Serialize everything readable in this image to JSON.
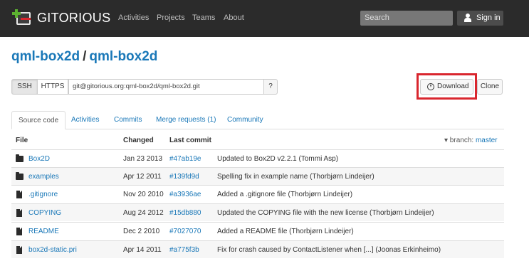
{
  "navbar": {
    "brand": "GITORIOUS",
    "links": [
      "Activities",
      "Projects",
      "Teams",
      "About"
    ],
    "search_placeholder": "Search",
    "signin_label": "Sign in"
  },
  "repo": {
    "project": "qml-box2d",
    "separator": "/",
    "name": "qml-box2d"
  },
  "clone_bar": {
    "ssh_label": "SSH",
    "https_label": "HTTPS",
    "url": "git@gitorious.org:qml-box2d/qml-box2d.git",
    "help_label": "?",
    "download_label": "Download",
    "clone_label": "Clone"
  },
  "tabs": [
    "Source code",
    "Activities",
    "Commits",
    "Merge requests (1)",
    "Community"
  ],
  "table": {
    "headers": {
      "file": "File",
      "changed": "Changed",
      "last_commit": "Last commit"
    },
    "branch_prefix": "▾ branch:",
    "branch_name": "master",
    "rows": [
      {
        "type": "folder",
        "name": "Box2D",
        "changed": "Jan 23 2013",
        "hash": "#47ab19e",
        "message": "Updated to Box2D v2.2.1 (Tommi Asp)"
      },
      {
        "type": "folder",
        "name": "examples",
        "changed": "Apr 12 2011",
        "hash": "#139fd9d",
        "message": "Spelling fix in example name (Thorbjørn Lindeijer)"
      },
      {
        "type": "file",
        "name": ".gitignore",
        "changed": "Nov 20 2010",
        "hash": "#a3936ae",
        "message": "Added a .gitignore file (Thorbjørn Lindeijer)"
      },
      {
        "type": "file",
        "name": "COPYING",
        "changed": "Aug 24 2012",
        "hash": "#15db880",
        "message": "Updated the COPYING file with the new license (Thorbjørn Lindeijer)"
      },
      {
        "type": "file",
        "name": "README",
        "changed": "Dec 2 2010",
        "hash": "#7027070",
        "message": "Added a README file (Thorbjørn Lindeijer)"
      },
      {
        "type": "file",
        "name": "box2d-static.pri",
        "changed": "Apr 14 2011",
        "hash": "#a775f3b",
        "message": "Fix for crash caused by ContactListener when [...] (Joonas Erkinheimo)"
      }
    ]
  },
  "colors": {
    "navbar_bg": "#2b2b2b",
    "link_blue": "#1a78b8",
    "highlight_red": "#d9262e",
    "logo_green": "#5cb130"
  }
}
